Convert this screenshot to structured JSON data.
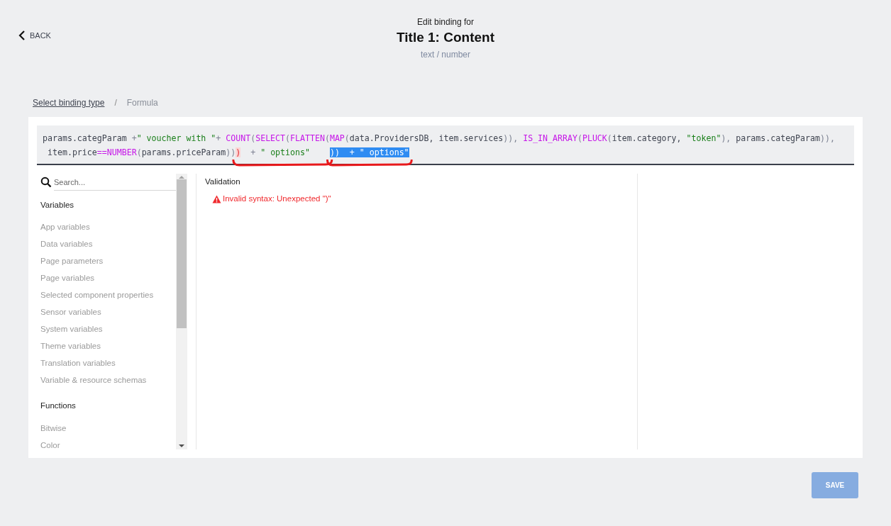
{
  "header": {
    "back": "BACK",
    "overline": "Edit binding for",
    "title": "Title 1: Content",
    "subtitle": "text / number"
  },
  "breadcrumb": [
    {
      "label": "Select binding type",
      "kind": "link"
    },
    {
      "label": "/",
      "kind": "separator"
    },
    {
      "label": "Formula",
      "kind": "current"
    }
  ],
  "formula": {
    "lines": [
      [
        {
          "marked": false,
          "tokens": [
            {
              "t": "params.categParam ",
              "kind": "text"
            },
            {
              "t": "+",
              "kind": "punct"
            },
            {
              "t": "\" voucher with \"",
              "kind": "str"
            },
            {
              "t": "+ ",
              "kind": "punct"
            },
            {
              "t": "COUNT",
              "kind": "fn"
            },
            {
              "t": "(",
              "kind": "punct"
            },
            {
              "t": "SELECT",
              "kind": "fn"
            },
            {
              "t": "(",
              "kind": "punct"
            },
            {
              "t": "FLATTEN",
              "kind": "fn"
            },
            {
              "t": "(",
              "kind": "punct"
            },
            {
              "t": "MAP",
              "kind": "fn"
            },
            {
              "t": "(",
              "kind": "punct"
            },
            {
              "t": "data.ProvidersDB, item.services",
              "kind": "text"
            },
            {
              "t": ")), ",
              "kind": "punct"
            },
            {
              "t": "IS_IN_ARRAY",
              "kind": "fn"
            },
            {
              "t": "(",
              "kind": "punct"
            },
            {
              "t": "PLUCK",
              "kind": "fn"
            },
            {
              "t": "(",
              "kind": "punct"
            },
            {
              "t": "item.category, ",
              "kind": "text"
            },
            {
              "t": "\"token\"",
              "kind": "str"
            },
            {
              "t": "), ",
              "kind": "punct"
            },
            {
              "t": "params.categParam",
              "kind": "text"
            },
            {
              "t": ")),",
              "kind": "punct"
            }
          ]
        }
      ],
      [
        {
          "marked": false,
          "tokens": [
            {
              "t": " item.price",
              "kind": "text"
            },
            {
              "t": "==",
              "kind": "fn"
            },
            {
              "t": "NUMBER",
              "kind": "fn"
            },
            {
              "t": "(",
              "kind": "punct"
            },
            {
              "t": "params.priceParam",
              "kind": "text"
            },
            {
              "t": "))",
              "kind": "punct"
            }
          ]
        },
        {
          "marked": true,
          "tokens": [
            {
              "t": ")",
              "kind": "error"
            },
            {
              "t": "  + ",
              "kind": "punct"
            },
            {
              "t": "\" options\"    ",
              "kind": "str"
            }
          ]
        },
        {
          "marked": true,
          "tokens": [
            {
              "t": "))  + \" options\"",
              "kind": "selected"
            }
          ]
        }
      ]
    ]
  },
  "search": {
    "placeholder": "Search..."
  },
  "sidebar": {
    "sections": [
      {
        "title": "Variables",
        "items": [
          "App variables",
          "Data variables",
          "Page parameters",
          "Page variables",
          "Selected component properties",
          "Sensor variables",
          "System variables",
          "Theme variables",
          "Translation variables",
          "Variable & resource schemas"
        ]
      },
      {
        "title": "Functions",
        "items": [
          "Bitwise",
          "Color"
        ]
      }
    ]
  },
  "validation": {
    "title": "Validation",
    "error": "Invalid syntax: Unexpected \")\""
  },
  "save_button": {
    "label": "SAVE",
    "disabled": true
  }
}
